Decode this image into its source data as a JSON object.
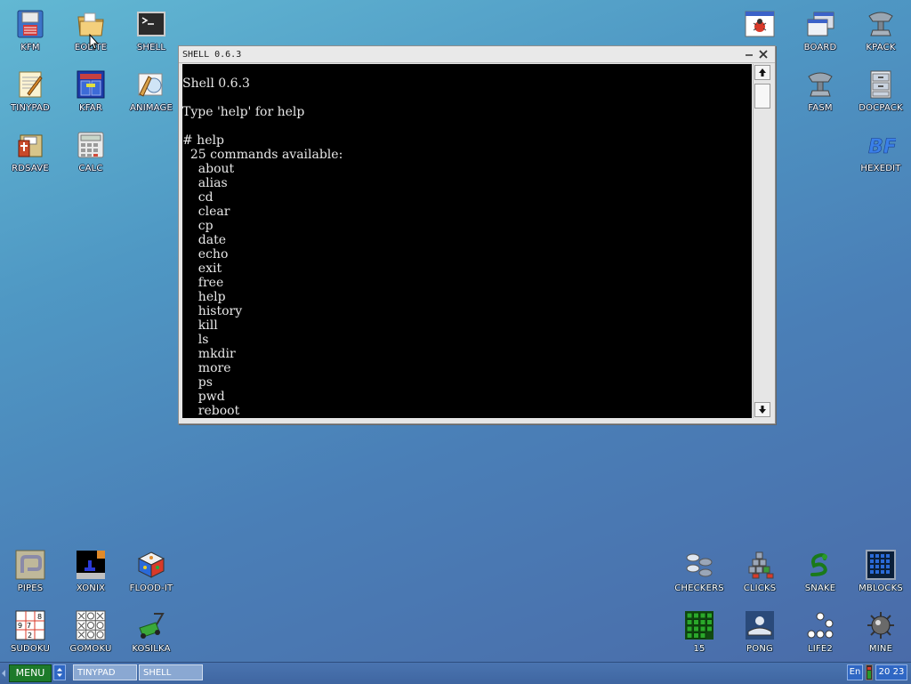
{
  "desktop_icons": {
    "kfm": "KFM",
    "eolite": "EOLITE",
    "shell": "SHELL",
    "tinypad": "TINYPAD",
    "kfar": "KFAR",
    "animage": "ANIMAGE",
    "rdsave": "RDSAVE",
    "calc": "CALC",
    "board": "BOARD",
    "kpack": "KPACK",
    "fasm": "FASM",
    "docpack": "DOCPACK",
    "hexedit": "HEXEDIT",
    "pipes": "PIPES",
    "xonix": "XONIX",
    "flood_it": "FLOOD-IT",
    "sudoku": "SUDOKU",
    "gomoku": "GOMOKU",
    "kosilka": "KOSILKA",
    "checkers": "CHECKERS",
    "clicks": "CLICKS",
    "snake": "SNAKE",
    "mblocks": "MBLOCKS",
    "fifteen": "15",
    "pong": "PONG",
    "life2": "LIFE2",
    "mine": "MINE"
  },
  "window": {
    "title": "SHELL 0.6.3",
    "lines": [
      "Shell 0.6.3",
      "Type 'help' for help",
      "# help",
      "  25 commands available:",
      "    about",
      "    alias",
      "    cd",
      "    clear",
      "    cp",
      "    date",
      "    echo",
      "    exit",
      "    free",
      "    help",
      "    history",
      "    kill",
      "    ls",
      "    mkdir",
      "    more",
      "    ps",
      "    pwd",
      "    reboot"
    ]
  },
  "taskbar": {
    "menu_label": "MENU",
    "tasks": [
      "TINYPAD",
      "SHELL"
    ],
    "lang": "En",
    "clock_hour": "20",
    "clock_minute": "23"
  },
  "colors": {
    "terminal_bg": "#000000",
    "terminal_fg": "#e8e8e8",
    "menu_green": "#1d7a2a",
    "tray_blue": "#2f67c4"
  }
}
